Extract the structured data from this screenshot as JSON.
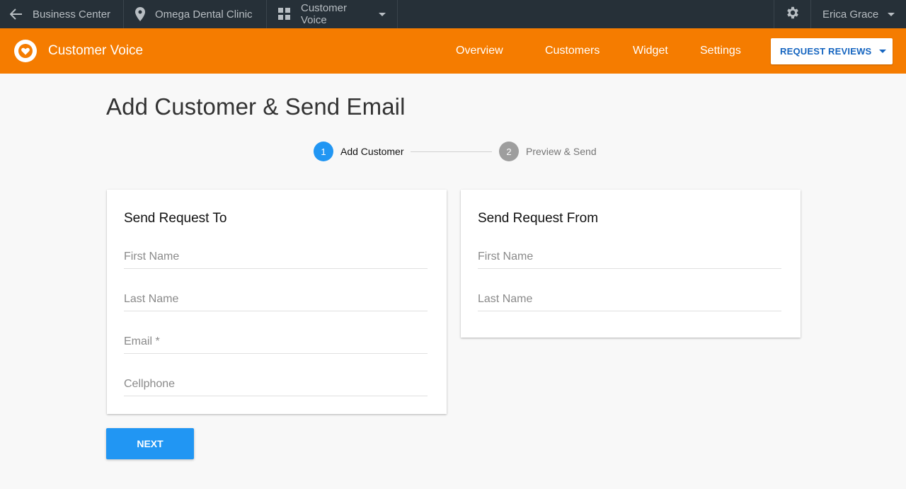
{
  "topbar": {
    "back_label": "Business Center",
    "location": "Omega Dental Clinic",
    "app_switcher": "Customer Voice",
    "user_name": "Erica Grace"
  },
  "appbar": {
    "title": "Customer Voice",
    "nav": [
      "Overview",
      "Customers",
      "Widget",
      "Settings"
    ],
    "request_button": "REQUEST REVIEWS"
  },
  "page": {
    "title": "Add Customer & Send Email"
  },
  "stepper": {
    "steps": [
      {
        "number": "1",
        "label": "Add Customer"
      },
      {
        "number": "2",
        "label": "Preview & Send"
      }
    ]
  },
  "send_to": {
    "title": "Send Request To",
    "fields": [
      {
        "placeholder": "First Name",
        "value": ""
      },
      {
        "placeholder": "Last Name",
        "value": ""
      },
      {
        "placeholder": "Email *",
        "value": ""
      },
      {
        "placeholder": "Cellphone",
        "value": ""
      }
    ]
  },
  "send_from": {
    "title": "Send Request From",
    "fields": [
      {
        "placeholder": "First Name",
        "value": ""
      },
      {
        "placeholder": "Last Name",
        "value": ""
      }
    ]
  },
  "actions": {
    "next_label": "NEXT"
  },
  "colors": {
    "topbar_bg": "#263038",
    "brand_orange": "#f57c00",
    "primary_blue": "#2196f3",
    "step_active": "#2196f3",
    "step_inactive": "#9e9e9e"
  }
}
